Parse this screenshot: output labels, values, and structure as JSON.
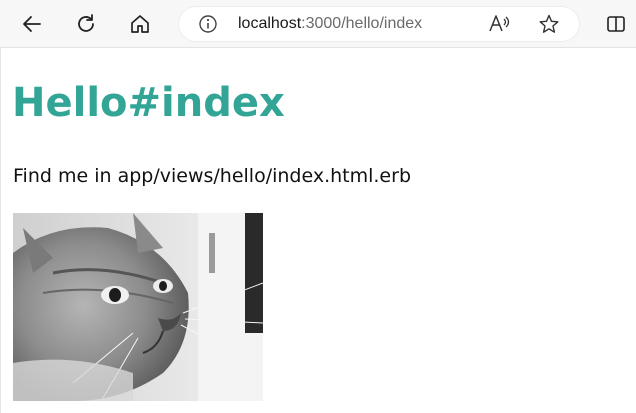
{
  "browser": {
    "url_host": "localhost",
    "url_rest": ":3000/hello/index",
    "icons": {
      "back": "back-arrow-icon",
      "refresh": "refresh-icon",
      "home": "home-icon",
      "info": "info-icon",
      "read_aloud": "read-aloud-icon",
      "favorite": "star-icon",
      "split": "split-screen-icon"
    }
  },
  "page": {
    "heading": "Hello#index",
    "description": "Find me in app/views/hello/index.html.erb",
    "heading_color": "#32a597"
  },
  "image": {
    "subject": "grayscale photo of a long-haired cat"
  }
}
